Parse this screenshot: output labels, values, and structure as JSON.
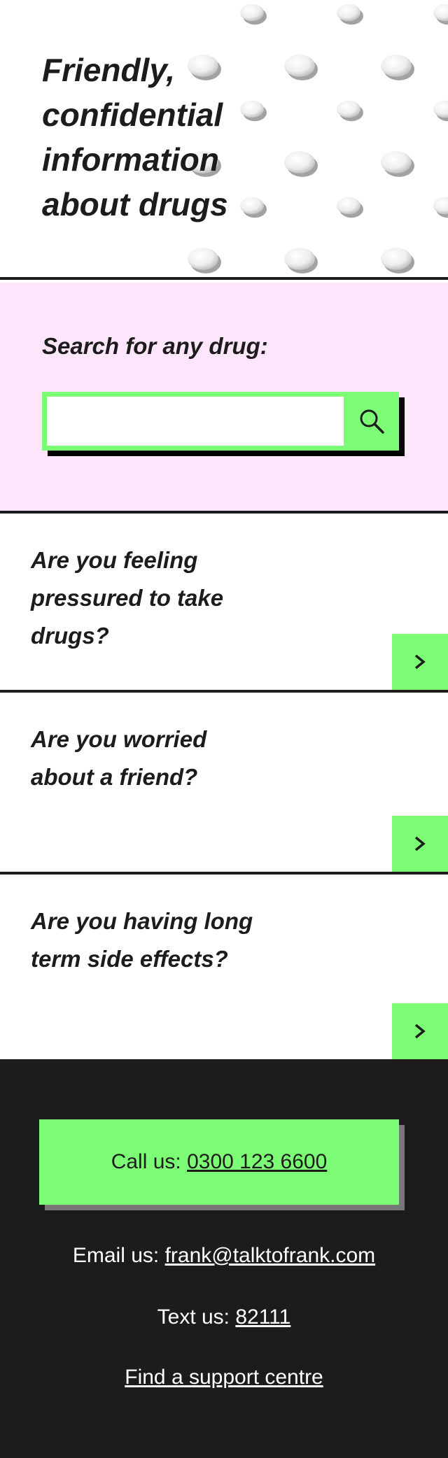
{
  "hero": {
    "title": "Friendly, confidential information about drugs"
  },
  "search": {
    "label": "Search for any drug:",
    "input_value": "",
    "button_icon": "search-icon"
  },
  "cards": [
    {
      "text": "Are you feeling pressured to take drugs?",
      "icon": "chevron-right-icon"
    },
    {
      "text": "Are you worried about a friend?",
      "icon": "chevron-right-icon"
    },
    {
      "text": "Are you having long term side effects?",
      "icon": "chevron-right-icon"
    }
  ],
  "footer": {
    "call_label": "Call us:",
    "call_number": "0300 123 6600",
    "email_label": "Email us:",
    "email_address": "frank@talktofrank.com",
    "text_label": "Text us:",
    "text_number": "82111",
    "support_link": "Find a support centre"
  },
  "colors": {
    "accent_green": "#7dfd75",
    "search_bg": "#fde6fb",
    "dark": "#1c1c1c"
  }
}
